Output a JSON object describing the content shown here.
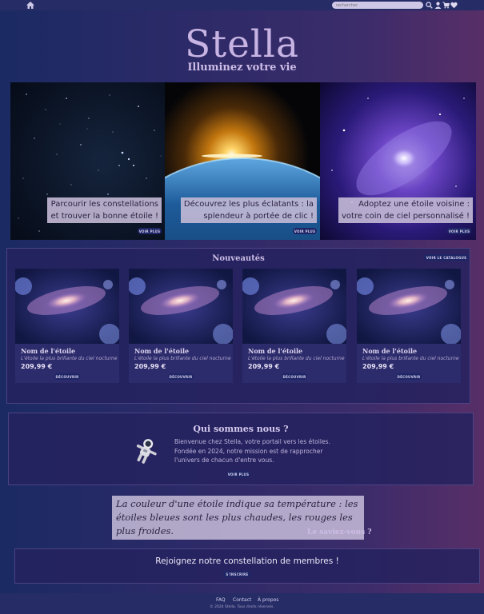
{
  "header": {
    "search": {
      "placeholder": "rechercher",
      "value": ""
    },
    "icons": [
      "home-icon",
      "search-icon",
      "user-icon",
      "cart-icon",
      "heart-icon"
    ]
  },
  "brand": {
    "name": "Stella",
    "tagline": "Illuminez votre vie"
  },
  "hero": [
    {
      "caption_line1": "Parcourir les constellations",
      "caption_line2": "et trouver la bonne étoile !",
      "button": "VOIR PLUS"
    },
    {
      "caption_line1": "Découvrez les plus éclatants : la",
      "caption_line2": "splendeur à portée de clic !",
      "button": "VOIR PLUS"
    },
    {
      "caption_line1": "Adoptez une étoile voisine :",
      "caption_line2": "votre coin de ciel personnalisé !",
      "button": "VOIR PLUS"
    }
  ],
  "new_arrivals": {
    "title": "Nouveautés",
    "catalog_button": "VOIR LE CATALOGUE",
    "cards": [
      {
        "name": "Nom de l'étoile",
        "subtitle": "L'étoile la plus brillante du ciel nocturne",
        "price": "209,99 €",
        "button": "DÉCOUVRIR"
      },
      {
        "name": "Nom de l'étoile",
        "subtitle": "L'étoile la plus brillante du ciel nocturne",
        "price": "209,99 €",
        "button": "DÉCOUVRIR"
      },
      {
        "name": "Nom de l'étoile",
        "subtitle": "L'étoile la plus brillante du ciel nocturne",
        "price": "209,99 €",
        "button": "DÉCOUVRIR"
      },
      {
        "name": "Nom de l'étoile",
        "subtitle": "L'étoile la plus brillante du ciel nocturne",
        "price": "209,99 €",
        "button": "DÉCOUVRIR"
      }
    ]
  },
  "about": {
    "title": "Qui sommes nous ?",
    "line1": "Bienvenue chez Stella, votre portail vers les étoiles.",
    "line2": "Fondée en 2024, notre mission est de rapprocher",
    "line3": "l'univers de chacun d'entre vous.",
    "button": "VOIR PLUS"
  },
  "fact": {
    "text": "La couleur d'une étoile indique sa température : les étoiles bleues sont les plus chaudes, les rouges les plus froides.",
    "label": "Le saviez-vous ?"
  },
  "join": {
    "title": "Rejoignez notre constellation de membres !",
    "button": "S'INSCRIRE"
  },
  "footer": {
    "links": [
      "FAQ",
      "Contact",
      "À propos"
    ],
    "copyright": "© 2024 Stella. Tous droits réservés."
  },
  "colors": {
    "background_left": "#1b2a63",
    "background_right": "#582e67",
    "brand": "#c7b4e3",
    "button": "#1e2666",
    "caption_bg": "#c4bad6"
  }
}
